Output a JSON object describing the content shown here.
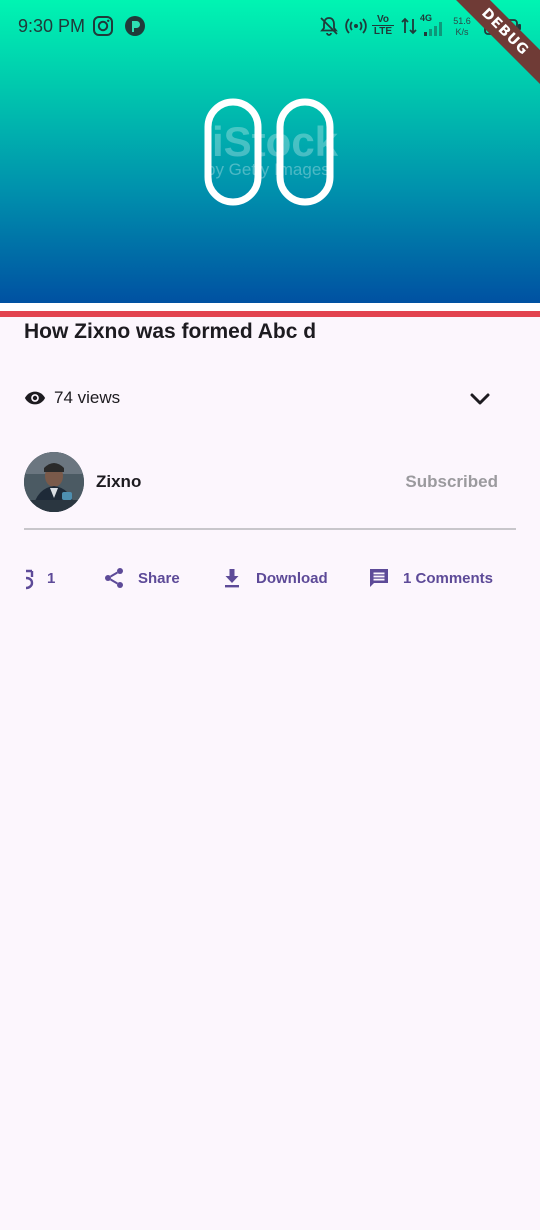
{
  "status_bar": {
    "time": "9:30 PM",
    "net_speed_value": "51.6",
    "net_speed_unit": "K/s",
    "network_type": "4G",
    "volte_top": "Vo",
    "volte_bottom": "LTE",
    "debug_label": "DEBUG"
  },
  "player": {
    "display_digits": "00",
    "watermark_brand": "iStock",
    "watermark_sub": "by Getty Images",
    "progress_color": "#e2434f"
  },
  "video": {
    "title": "How Zixno was formed Abc d",
    "views_label": "74 views"
  },
  "channel": {
    "name": "Zixno",
    "subscribe_label": "Subscribed"
  },
  "actions": {
    "like_count": "1",
    "share_label": "Share",
    "download_label": "Download",
    "comments_label": "1 Comments"
  },
  "colors": {
    "accent": "#5d4a98",
    "background": "#fcf6fd"
  }
}
